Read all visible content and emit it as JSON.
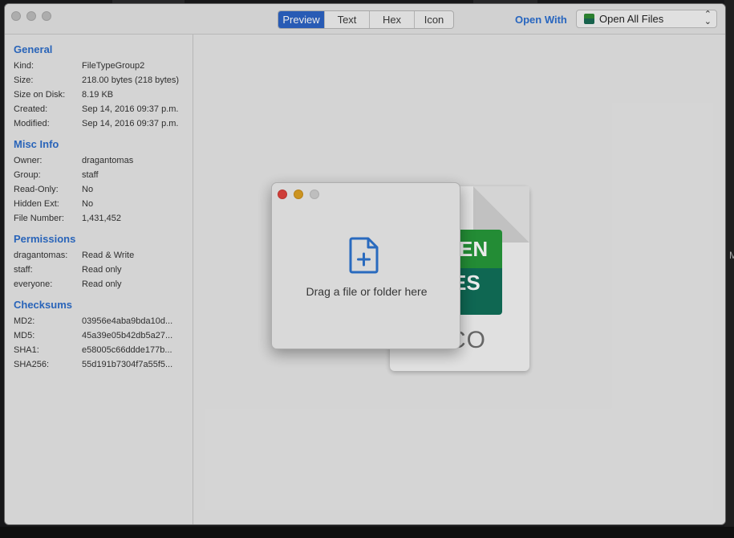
{
  "toolbar": {
    "tabs": [
      {
        "label": "Preview",
        "active": true
      },
      {
        "label": "Text",
        "active": false
      },
      {
        "label": "Hex",
        "active": false
      },
      {
        "label": "Icon",
        "active": false
      }
    ],
    "open_with_label": "Open With",
    "open_with_value": "Open All Files",
    "open_with_icon": "green-app-icon"
  },
  "sidebar": {
    "general": {
      "title": "General",
      "rows": [
        {
          "label": "Kind:",
          "value": "FileTypeGroup2"
        },
        {
          "label": "Size:",
          "value": "218.00 bytes (218 bytes)"
        },
        {
          "label": "Size on Disk:",
          "value": "8.19 KB"
        },
        {
          "label": "Created:",
          "value": "Sep 14, 2016 09:37 p.m."
        },
        {
          "label": "Modified:",
          "value": "Sep 14, 2016 09:37 p.m."
        }
      ]
    },
    "misc": {
      "title": "Misc Info",
      "rows": [
        {
          "label": "Owner:",
          "value": "dragantomas"
        },
        {
          "label": "Group:",
          "value": "staff"
        },
        {
          "label": "Read-Only:",
          "value": "No"
        },
        {
          "label": "Hidden Ext:",
          "value": "No"
        },
        {
          "label": "File Number:",
          "value": "1,431,452"
        }
      ]
    },
    "permissions": {
      "title": "Permissions",
      "rows": [
        {
          "label": "dragantomas:",
          "value": "Read & Write"
        },
        {
          "label": "staff:",
          "value": "Read only"
        },
        {
          "label": "everyone:",
          "value": "Read only"
        }
      ]
    },
    "checksums": {
      "title": "Checksums",
      "rows": [
        {
          "label": "MD2:",
          "value": "03956e4aba9bda10d..."
        },
        {
          "label": "MD5:",
          "value": "45a39e05b42db5a27..."
        },
        {
          "label": "SHA1:",
          "value": "e58005c66ddde177b..."
        },
        {
          "label": "SHA256:",
          "value": "55d191b7304f7a55f5..."
        }
      ]
    }
  },
  "preview": {
    "brand_line1": "EN",
    "brand_line2": "ES",
    "extension": "ACO",
    "drop_text": "Drag a file or folder here",
    "drop_icon": "file-plus-icon"
  },
  "colors": {
    "accent": "#2c63c5",
    "section_title": "#2d6dc9",
    "brand_green": "#26983a",
    "brand_dark_green": "#11705a"
  }
}
